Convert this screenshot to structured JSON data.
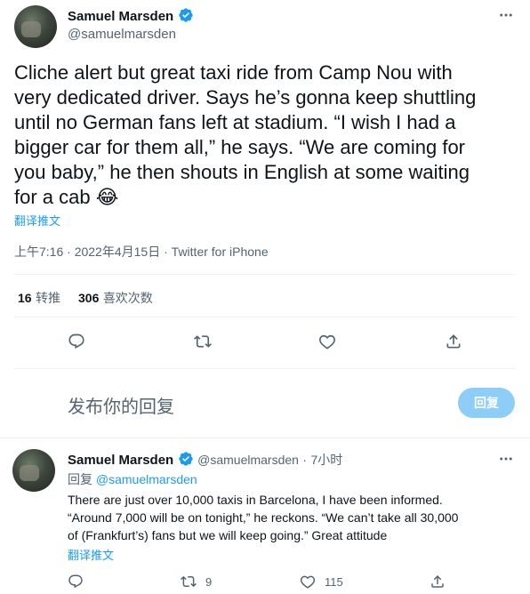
{
  "main_tweet": {
    "author_name": "Samuel Marsden",
    "author_handle": "@samuelmarsden",
    "text_lines": [
      "Cliche alert but great taxi ride from Camp Nou with",
      "very dedicated driver. Says he’s gonna keep shuttling",
      "until no German fans left at stadium. “I wish I had a",
      "bigger car for them all,” he says. “We are coming for",
      "you baby,” he then shouts in English at some waiting",
      "for a cab 😂"
    ],
    "translate_label": "翻译推文",
    "time": "上午7:16",
    "date": "2022年4月15日",
    "source": "Twitter for iPhone",
    "separator": "·",
    "retweet_count": "16",
    "retweet_label": "转推",
    "like_count": "306",
    "like_label": "喜欢次数"
  },
  "composer": {
    "placeholder": "发布你的回复",
    "button_label": "回复"
  },
  "reply_tweet": {
    "author_name": "Samuel Marsden",
    "author_handle": "@samuelmarsden",
    "separator": "·",
    "time_ago": "7小时",
    "replying_to_prefix": "回复",
    "replying_to_handle": "@samuelmarsden",
    "text_lines": [
      "There are just over 10,000 taxis in Barcelona, I have been informed.",
      "“Around 7,000 will be on tonight,” he reckons. “We can’t take all 30,000",
      "of (Frankfurt’s) fans but we will keep going.” Great attitude"
    ],
    "translate_label": "翻译推文",
    "retweet_count": "9",
    "like_count": "115"
  },
  "colors": {
    "accent": "#1d9bf0",
    "muted_text": "#536471",
    "reply_button_disabled": "#8ecdf8"
  }
}
